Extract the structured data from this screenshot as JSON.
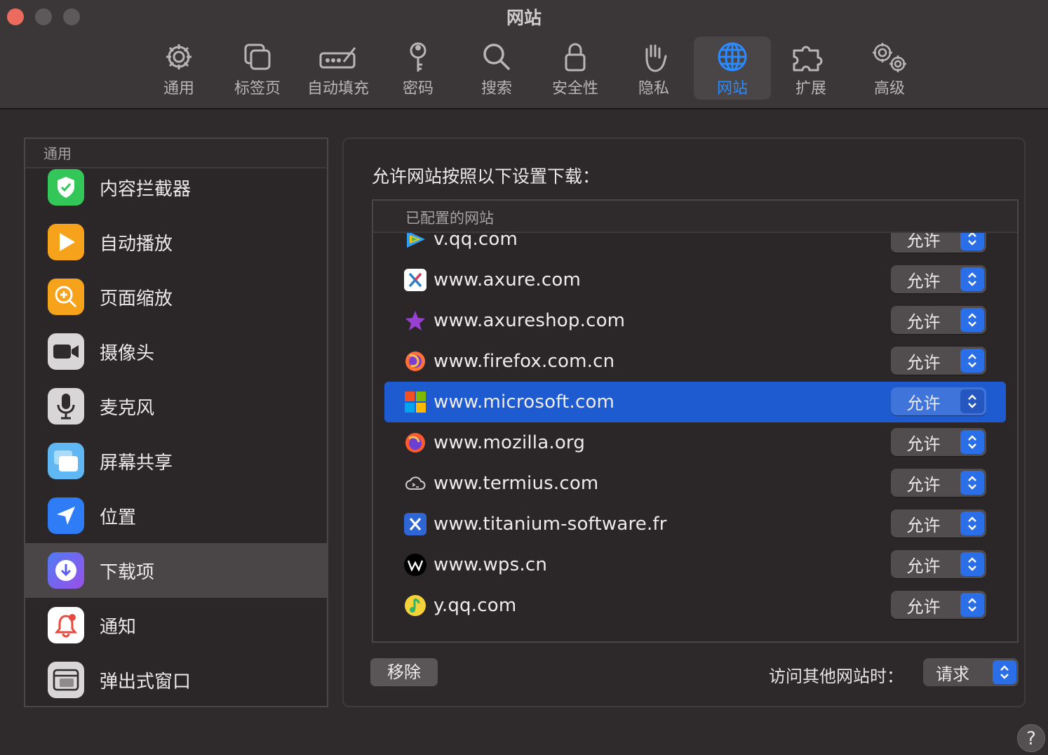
{
  "window": {
    "title": "网站"
  },
  "toolbar": {
    "tabs": [
      {
        "label": "通用",
        "icon": "gear-icon"
      },
      {
        "label": "标签页",
        "icon": "tabs-icon"
      },
      {
        "label": "自动填充",
        "icon": "autofill-icon"
      },
      {
        "label": "密码",
        "icon": "key-icon"
      },
      {
        "label": "搜索",
        "icon": "search-icon"
      },
      {
        "label": "安全性",
        "icon": "lock-icon"
      },
      {
        "label": "隐私",
        "icon": "hand-icon"
      },
      {
        "label": "网站",
        "icon": "globe-icon",
        "active": true
      },
      {
        "label": "扩展",
        "icon": "puzzle-icon"
      },
      {
        "label": "高级",
        "icon": "gears-icon"
      }
    ]
  },
  "sidebar": {
    "header": "通用",
    "items": [
      {
        "label": "内容拦截器",
        "icon": "content-blocker-icon",
        "color": "#33c759"
      },
      {
        "label": "自动播放",
        "icon": "autoplay-icon",
        "color": "#f6a21b"
      },
      {
        "label": "页面缩放",
        "icon": "page-zoom-icon",
        "color": "#f6a21b"
      },
      {
        "label": "摄像头",
        "icon": "camera-icon",
        "color": "#6e6a6b"
      },
      {
        "label": "麦克风",
        "icon": "microphone-icon",
        "color": "#d8d5d6"
      },
      {
        "label": "屏幕共享",
        "icon": "screen-sharing-icon",
        "color": "#5fb8f3"
      },
      {
        "label": "位置",
        "icon": "location-icon",
        "color": "#2e7cf6"
      },
      {
        "label": "下载项",
        "icon": "downloads-icon",
        "color": "#7b5cf0",
        "selected": true
      },
      {
        "label": "通知",
        "icon": "notifications-icon",
        "color": "#ffffff"
      },
      {
        "label": "弹出式窗口",
        "icon": "popup-windows-icon",
        "color": "#d8d5d6"
      }
    ]
  },
  "main": {
    "heading": "允许网站按照以下设置下载：",
    "table_header": "已配置的网站",
    "sites": [
      {
        "domain": "v.qq.com",
        "setting": "允许",
        "icon": "tencent-video-icon"
      },
      {
        "domain": "www.axure.com",
        "setting": "允许",
        "icon": "axure-icon"
      },
      {
        "domain": "www.axureshop.com",
        "setting": "允许",
        "icon": "axureshop-star-icon"
      },
      {
        "domain": "www.firefox.com.cn",
        "setting": "允许",
        "icon": "firefox-icon"
      },
      {
        "domain": "www.microsoft.com",
        "setting": "允许",
        "icon": "microsoft-icon",
        "selected": true
      },
      {
        "domain": "www.mozilla.org",
        "setting": "允许",
        "icon": "firefox-icon"
      },
      {
        "domain": "www.termius.com",
        "setting": "允许",
        "icon": "termius-icon"
      },
      {
        "domain": "www.titanium-software.fr",
        "setting": "允许",
        "icon": "titanium-icon"
      },
      {
        "domain": "www.wps.cn",
        "setting": "允许",
        "icon": "wps-icon"
      },
      {
        "domain": "y.qq.com",
        "setting": "允许",
        "icon": "qq-music-icon"
      }
    ],
    "remove_button": "移除",
    "other_sites_label": "访问其他网站时：",
    "other_sites_value": "请求"
  },
  "help_button": "?",
  "colors": {
    "accent": "#2a8bff",
    "selection": "#1f5bd0",
    "close": "#ed6a5e"
  }
}
